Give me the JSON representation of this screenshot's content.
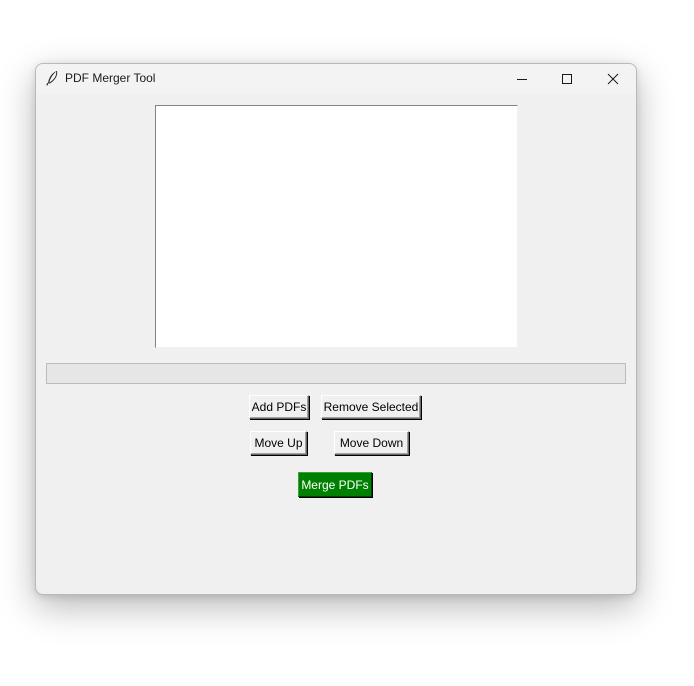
{
  "window": {
    "title": "PDF Merger Tool",
    "app_icon": "feather-icon",
    "controls": {
      "minimize_icon": "minimize-icon",
      "maximize_icon": "maximize-icon",
      "close_icon": "close-icon"
    }
  },
  "file_list": {
    "items": []
  },
  "progress": {
    "value": 0
  },
  "buttons": {
    "add": "Add PDFs",
    "remove": "Remove Selected",
    "move_up": "Move Up",
    "move_down": "Move Down",
    "merge": "Merge PDFs"
  },
  "colors": {
    "merge_background": "#008000",
    "merge_text": "#ffffff",
    "window_background": "#f0f0f0"
  }
}
